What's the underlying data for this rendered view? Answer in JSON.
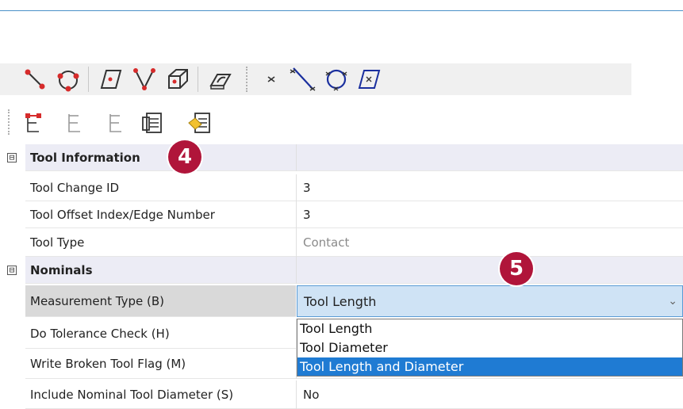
{
  "toolbar1": {
    "icons": [
      "line-icon",
      "circle-points-icon",
      "plane-icon",
      "cone-icon",
      "cube-icon",
      "slot-icon",
      "point-icon",
      "line-construct-icon",
      "circle-construct-icon",
      "plane-construct-icon"
    ]
  },
  "toolbar2": {
    "icons": [
      "tool-tree-red-icon",
      "tool-tree-gray-icon",
      "tool-tree-gray2-icon",
      "paste-icon",
      "tag-list-icon"
    ]
  },
  "badges": {
    "step4": "4",
    "step5": "5"
  },
  "grid": {
    "tool_info": {
      "header": "Tool Information",
      "expander": "⊟",
      "rows": [
        {
          "name": "Tool Change ID",
          "value": "3"
        },
        {
          "name": "Tool Offset Index/Edge Number",
          "value": "3"
        },
        {
          "name": "Tool Type",
          "value": "Contact"
        }
      ]
    },
    "nominals": {
      "header": "Nominals",
      "expander": "⊟",
      "measurement_type": {
        "name": "Measurement Type (B)",
        "value": "Tool Length"
      },
      "rows": [
        {
          "name": "Do Tolerance Check (H)"
        },
        {
          "name": "Write Broken Tool Flag (M)"
        },
        {
          "name": "Include Nominal Tool Diameter (S)",
          "value": "No"
        }
      ]
    }
  },
  "dropdown": {
    "options": [
      "Tool Length",
      "Tool Diameter",
      "Tool Length and Diameter"
    ],
    "highlighted": "Tool Length and Diameter"
  },
  "colors": {
    "badge": "#b0153a",
    "highlight": "#1f7bd3",
    "combo_bg": "#cfe3f5"
  }
}
